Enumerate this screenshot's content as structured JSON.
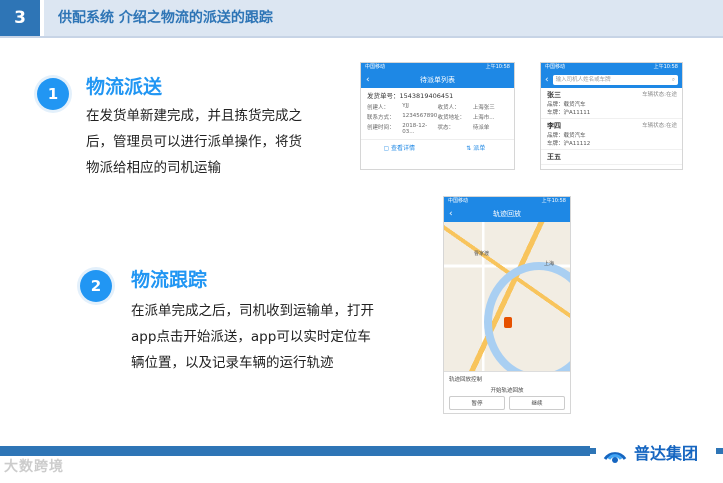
{
  "header": {
    "number": "3",
    "title": "供配系统 介绍之物流的派送的跟踪"
  },
  "section1": {
    "number": "1",
    "title": "物流派送",
    "lines": [
      "在发货单新建完成，并且拣货完成之",
      "后，管理员可以进行派单操作，将货",
      "物派给相应的司机运输"
    ]
  },
  "section2": {
    "number": "2",
    "title": "物流跟踪",
    "lines": [
      "在派单完成之后，司机收到运输单，打开",
      "app点击开始派送，app可以实时定位车",
      "辆位置，以及记录车辆的运行轨迹"
    ]
  },
  "phone_list": {
    "status_left": "中国移动",
    "status_right": "上午10:58",
    "title": "待派单列表",
    "order_no": "发货单号：1543819406451",
    "fields": [
      [
        "创建人：",
        "YJJ",
        "收货人：",
        "上海张三"
      ],
      [
        "联系方式：",
        "1234567890",
        "收货地址：",
        "上海市..."
      ],
      [
        "创建时间：",
        "2018-12-03...",
        "状态：",
        "待派单"
      ]
    ],
    "action_detail": "查看详情",
    "action_dispatch": "派单"
  },
  "phone_drivers": {
    "status_left": "中国移动",
    "status_right": "上午10:58",
    "search_placeholder": "输入司机人姓名或车牌",
    "drivers": [
      {
        "name": "张三",
        "state": "车辆状态:在途",
        "brand": "品牌：载货汽车",
        "plate": "车牌：沪A11111"
      },
      {
        "name": "李四",
        "state": "车辆状态:在途",
        "brand": "品牌：载货汽车",
        "plate": "车牌：沪A11112"
      },
      {
        "name": "王五",
        "state": "",
        "brand": "",
        "plate": ""
      }
    ]
  },
  "phone_map": {
    "status_left": "中国移动",
    "status_right": "上午10:58",
    "title": "轨迹回放",
    "panel_title": "轨迹回放控制",
    "start_label": "开始轨迹回放",
    "pause_label": "暂停",
    "continue_label": "继续",
    "map_labels": [
      "曹家渡",
      "上海"
    ]
  },
  "footer": {
    "company": "普达集团",
    "watermark": "大数跨境"
  }
}
